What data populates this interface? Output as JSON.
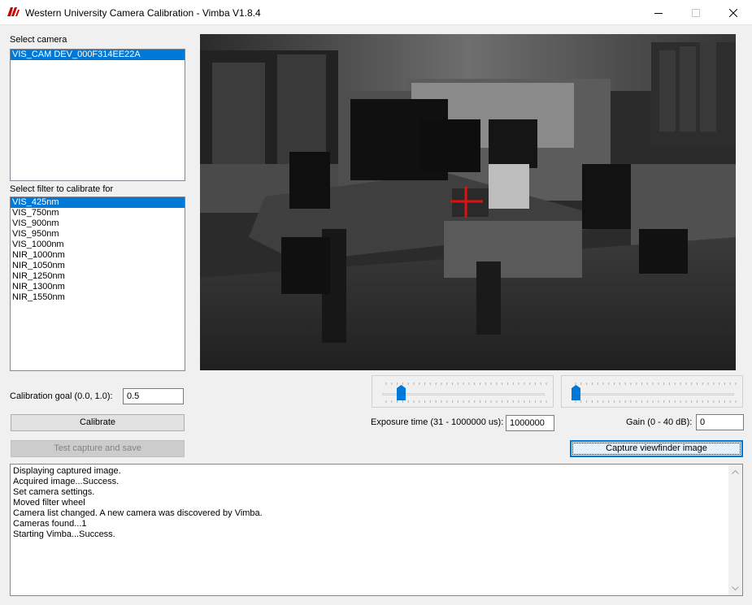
{
  "window": {
    "title": "Western University Camera Calibration - Vimba V1.8.4",
    "brand_color": "#cc0000"
  },
  "camera": {
    "label": "Select camera",
    "items": [
      {
        "label": "VIS_CAM DEV_000F314EE22A",
        "selected": true
      }
    ]
  },
  "filter": {
    "label": "Select filter to calibrate for",
    "items": [
      {
        "label": "VIS_425nm",
        "selected": true
      },
      {
        "label": "VIS_750nm"
      },
      {
        "label": "VIS_900nm"
      },
      {
        "label": "VIS_950nm"
      },
      {
        "label": "VIS_1000nm"
      },
      {
        "label": "NIR_1000nm"
      },
      {
        "label": "NIR_1050nm"
      },
      {
        "label": "NIR_1250nm"
      },
      {
        "label": "NIR_1300nm"
      },
      {
        "label": "NIR_1550nm"
      }
    ]
  },
  "calibration": {
    "goal_label": "Calibration goal (0.0, 1.0):",
    "goal_value": "0.5",
    "calibrate_label": "Calibrate",
    "test_capture_label": "Test capture and save"
  },
  "exposure": {
    "label": "Exposure time (31 - 1000000 us):",
    "value": "1000000",
    "slider_fraction": 0.09
  },
  "gain": {
    "label": "Gain (0 - 40 dB):",
    "value": "0",
    "slider_fraction": 0.0
  },
  "viewfinder": {
    "capture_label": "Capture viewfinder image",
    "crosshair_color": "#e01010"
  },
  "log": {
    "lines": [
      "Displaying captured image.",
      "Acquired image...Success.",
      "Set camera settings.",
      "Moved filter wheel",
      "Camera list changed. A new camera was discovered by Vimba.",
      "Cameras found...1",
      "Starting Vimba...Success."
    ]
  }
}
